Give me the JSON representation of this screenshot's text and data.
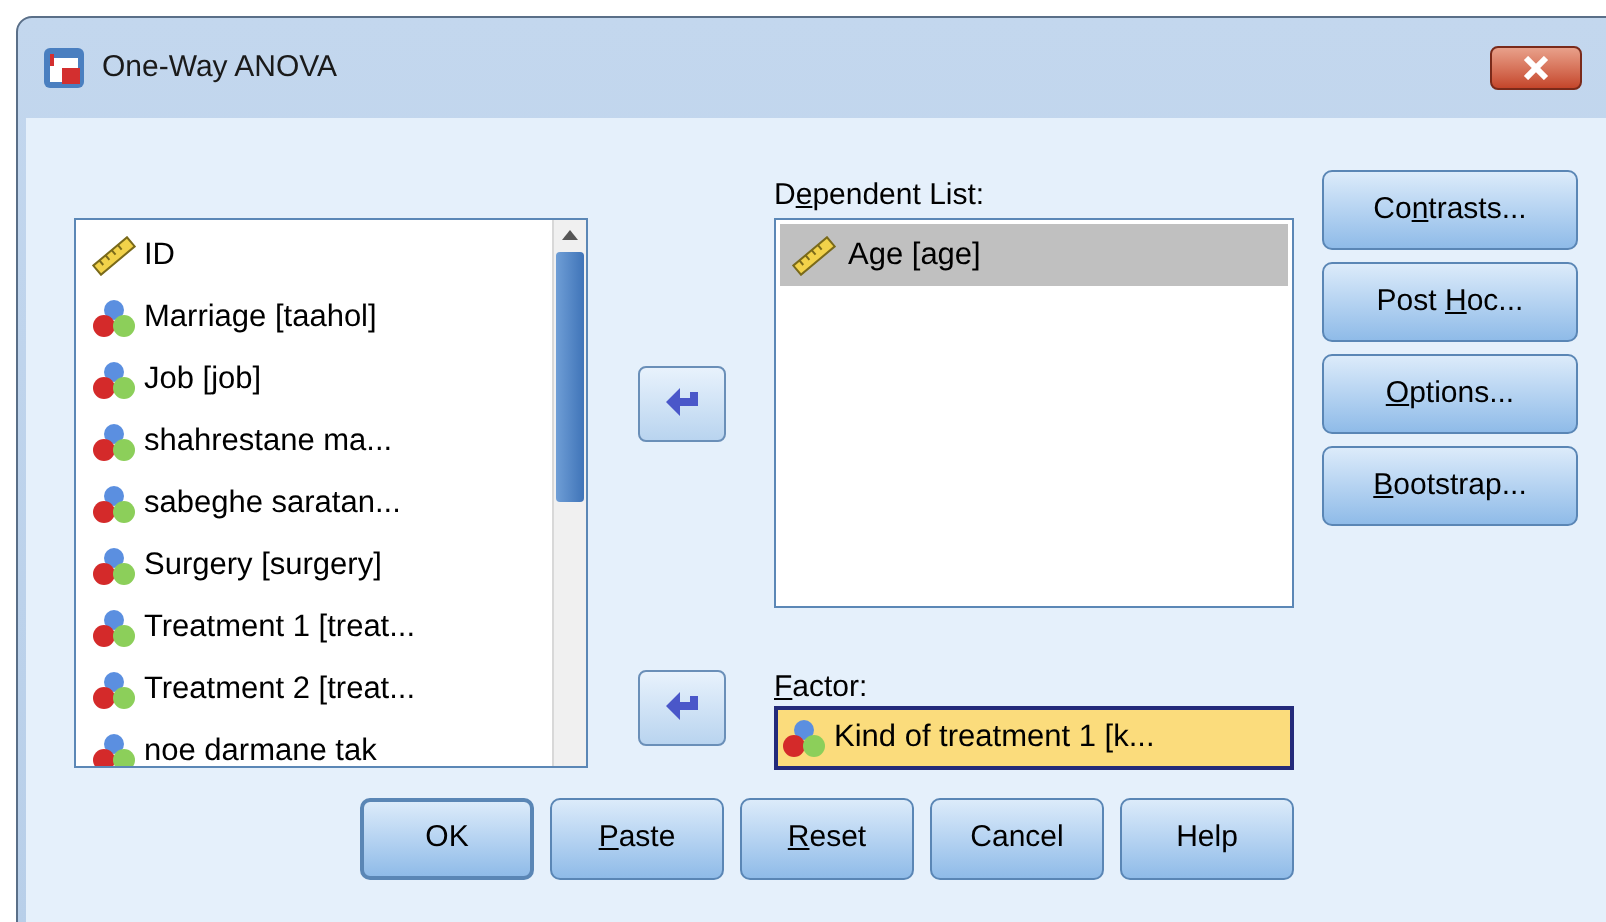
{
  "window": {
    "title": "One-Way ANOVA"
  },
  "variables": [
    {
      "kind": "scale",
      "label": "ID",
      "selected": false
    },
    {
      "kind": "nominal",
      "label": "Marriage [taahol]",
      "selected": false
    },
    {
      "kind": "nominal",
      "label": "Job [job]",
      "selected": false
    },
    {
      "kind": "nominal",
      "label": "shahrestane ma...",
      "selected": false
    },
    {
      "kind": "nominal",
      "label": "sabeghe saratan...",
      "selected": false
    },
    {
      "kind": "nominal",
      "label": "Surgery [surgery]",
      "selected": false
    },
    {
      "kind": "nominal",
      "label": "Treatment 1 [treat...",
      "selected": false
    },
    {
      "kind": "nominal",
      "label": "Treatment 2 [treat...",
      "selected": false
    },
    {
      "kind": "nominal",
      "label": "noe darmane tak",
      "selected": false
    }
  ],
  "dependent_list": {
    "label": {
      "pre": "D",
      "key": "e",
      "post": "pendent List:"
    },
    "items": [
      {
        "kind": "scale",
        "label": "Age [age]",
        "selected": true
      }
    ]
  },
  "factor": {
    "label": {
      "key": "F",
      "post": "actor:"
    },
    "item": {
      "kind": "nominal",
      "label": "Kind of treatment 1 [k..."
    }
  },
  "side_buttons": [
    {
      "label": {
        "pre": "Co",
        "key": "n",
        "post": "trasts..."
      }
    },
    {
      "label": {
        "pre": "Post ",
        "key": "H",
        "post": "oc..."
      }
    },
    {
      "label": {
        "key": "O",
        "post": "ptions..."
      }
    },
    {
      "label": {
        "key": "B",
        "post": "ootstrap..."
      }
    }
  ],
  "bottom_buttons": [
    {
      "label": {
        "pre": "OK"
      },
      "default": true
    },
    {
      "label": {
        "key": "P",
        "post": "aste"
      },
      "default": false
    },
    {
      "label": {
        "key": "R",
        "post": "eset"
      },
      "default": false
    },
    {
      "label": {
        "pre": "Cancel"
      },
      "default": false
    },
    {
      "label": {
        "pre": "Help"
      },
      "default": false
    }
  ]
}
